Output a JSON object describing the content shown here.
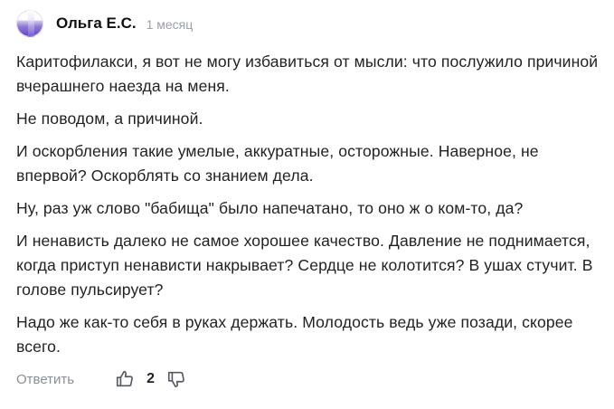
{
  "comment": {
    "author": "Ольга Е.С.",
    "time": "1 месяц",
    "paragraphs": [
      "Каритофилакси, я вот не могу избавиться от мысли: что послужило причиной вчерашнего наезда на меня.",
      "Не поводом, а причиной.",
      "И оскорбления такие умелые, аккуратные, осторожные. Наверное, не впервой? Оскорблять со знанием дела.",
      "Ну, раз уж слово \"бабища\" было напечатано, то оно ж о ком-то, да?",
      "И ненависть далеко не самое хорошее качество. Давление не поднимается, когда приступ ненависти накрывает? Сердце не колотится? В ушах стучит. В голове пульсирует?",
      "Надо же как-то себя в руках держать. Молодость ведь уже позади, скорее всего."
    ],
    "actions": {
      "reply_label": "Ответить",
      "like_icon": "thumbs-up-icon",
      "like_count": "2",
      "dislike_icon": "thumbs-down-icon"
    }
  },
  "colors": {
    "text": "#222222",
    "muted": "#9aa0a6",
    "avatar_accent": "#5b3fc0"
  }
}
